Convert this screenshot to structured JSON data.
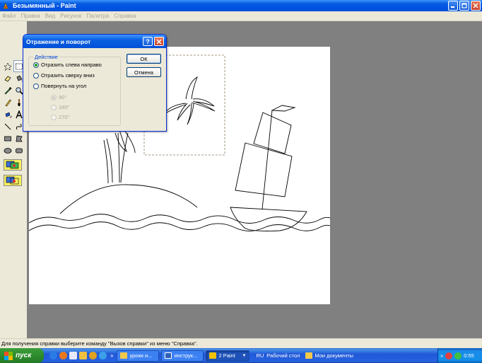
{
  "window": {
    "title": "Безымянный - Paint",
    "app_icon": "paint-icon",
    "buttons": [
      "minimize-icon",
      "maximize-icon",
      "close-icon"
    ]
  },
  "menu": {
    "items": [
      "Файл",
      "Правка",
      "Вид",
      "Рисунок",
      "Палитра",
      "Справка"
    ]
  },
  "tools": [
    "free-select-icon",
    "rect-select-icon",
    "eraser-icon",
    "fill-icon",
    "eyedropper-icon",
    "magnifier-icon",
    "pencil-icon",
    "brush-icon",
    "airbrush-icon",
    "text-icon",
    "line-icon",
    "curve-icon",
    "rectangle-icon",
    "polygon-icon",
    "ellipse-icon",
    "rounded-rect-icon"
  ],
  "palette": {
    "foreground": "#000000",
    "background": "#FFFFFF",
    "row1": [
      "#000000",
      "#808080",
      "#800000",
      "#808000",
      "#008000",
      "#008080",
      "#000080",
      "#800080",
      "#808040",
      "#004040",
      "#0080FF",
      "#004080",
      "#8000FF",
      "#804000"
    ],
    "row2": [
      "#FFFFFF",
      "#C0C0C0",
      "#FF0000",
      "#FFFF00",
      "#00FF00",
      "#00FFFF",
      "#0000FF",
      "#FF00FF",
      "#FFFF80",
      "#00FF80",
      "#80FFFF",
      "#8080FF",
      "#FF0080",
      "#FF8040"
    ]
  },
  "dialog": {
    "title": "Отражение и поворот",
    "group_label": "Действие",
    "options": [
      {
        "label": "Отразить слева направо",
        "selected": true,
        "enabled": true
      },
      {
        "label": "Отразить сверху вниз",
        "selected": false,
        "enabled": true
      },
      {
        "label": "Повернуть на угол",
        "selected": false,
        "enabled": true
      }
    ],
    "angles": [
      {
        "label": "90°",
        "selected": true
      },
      {
        "label": "180°",
        "selected": false
      },
      {
        "label": "270°",
        "selected": false
      }
    ],
    "ok_label": "ОК",
    "cancel_label": "Отмена"
  },
  "status": {
    "text": "Для получения справки выберите команду \"Вызов справки\" из меню \"Справка\"."
  },
  "taskbar": {
    "start_label": "пуск",
    "quick_launch": [
      "ie-icon",
      "firefox-icon",
      "notepad-icon",
      "explorer-icon",
      "media-icon",
      "messenger-icon"
    ],
    "chevron": "»",
    "tasks": [
      {
        "label": "уроки и...",
        "icon": "folder-icon",
        "active": false
      },
      {
        "label": "инструк...",
        "icon": "word-icon",
        "active": false
      },
      {
        "label": "2 Paint",
        "icon": "paint-icon",
        "active": true
      }
    ],
    "language": "RU",
    "desktop_label": "Рабочий стол",
    "documents_label": "Мои документы",
    "tray_chevron": "»",
    "clock": "0:55"
  }
}
